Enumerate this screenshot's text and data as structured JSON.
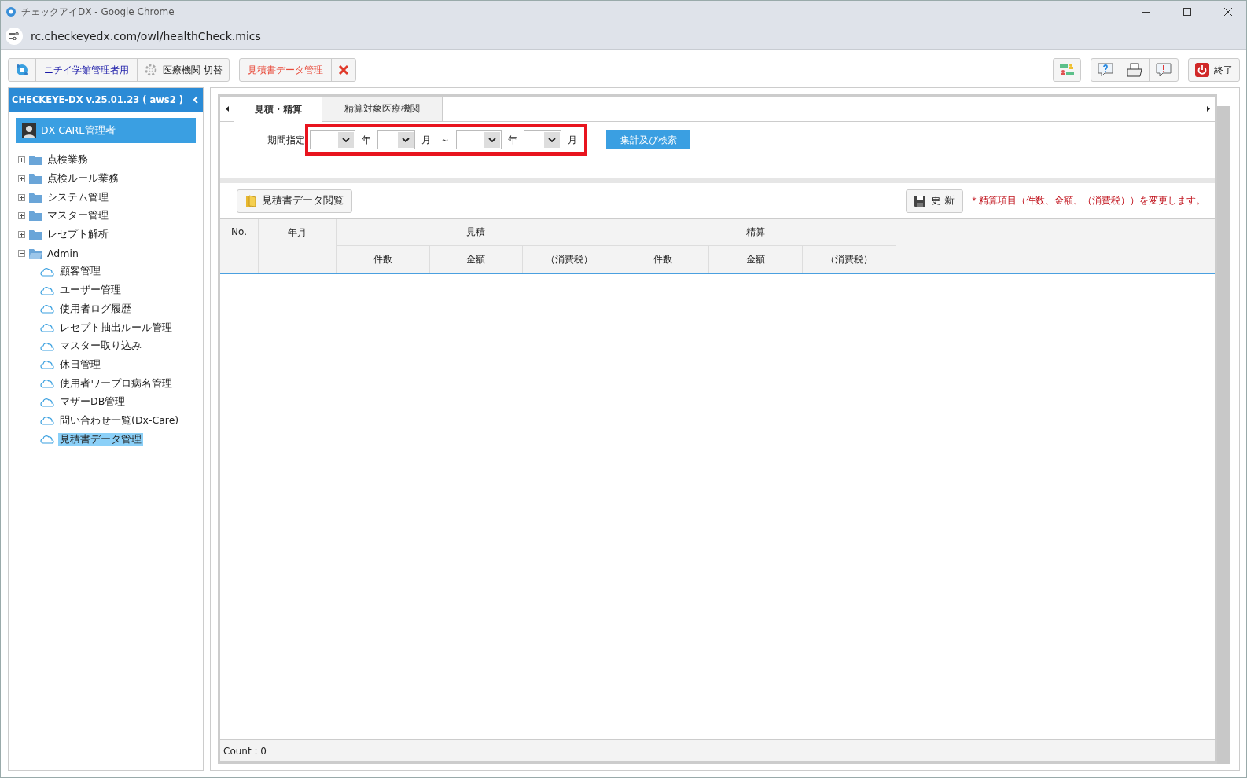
{
  "window": {
    "title": "チェックアイDX - Google Chrome",
    "url": "rc.checkeyedx.com/owl/healthCheck.mics"
  },
  "toolbar": {
    "org_label": "ニチイ学館管理者用",
    "switch_label": "医療機関 切替",
    "open_tab": "見積書データ管理",
    "exit_label": "終了"
  },
  "sidebar": {
    "version": "CHECKEYE-DX v.25.01.23 ( aws2 )",
    "user": "DX CARE管理者",
    "items": [
      {
        "label": "点検業務",
        "expanded": false
      },
      {
        "label": "点検ルール業務",
        "expanded": false
      },
      {
        "label": "システム管理",
        "expanded": false
      },
      {
        "label": "マスター管理",
        "expanded": false
      },
      {
        "label": "レセプト解析",
        "expanded": false
      },
      {
        "label": "Admin",
        "expanded": true,
        "children": [
          {
            "label": "顧客管理",
            "selected": false
          },
          {
            "label": "ユーザー管理",
            "selected": false
          },
          {
            "label": "使用者ログ履歴",
            "selected": false
          },
          {
            "label": "レセプト抽出ルール管理",
            "selected": false
          },
          {
            "label": "マスター取り込み",
            "selected": false
          },
          {
            "label": "休日管理",
            "selected": false
          },
          {
            "label": "使用者ワープロ病名管理",
            "selected": false
          },
          {
            "label": "マザーDB管理",
            "selected": false
          },
          {
            "label": "問い合わせ一覧(Dx-Care)",
            "selected": false
          },
          {
            "label": "見積書データ管理",
            "selected": true
          }
        ]
      }
    ]
  },
  "tabs": [
    {
      "label": "見積・精算",
      "selected": true
    },
    {
      "label": "精算対象医療機関",
      "selected": false
    }
  ],
  "filter": {
    "label": "期間指定",
    "highlighted": true,
    "from_year_unit": "年",
    "from_month_unit": "月",
    "to_year_unit": "年",
    "to_month_unit": "月",
    "range_sep": "～",
    "search_button": "集計及び検索"
  },
  "actions": {
    "view_button": "見積書データ閲覧",
    "update_button": "更 新",
    "note": "＊精算項目（件数、金額、（消費税））を変更します。"
  },
  "table": {
    "columns": [
      {
        "label": "No."
      },
      {
        "label": "年月"
      },
      {
        "label": "見積",
        "children": [
          "件数",
          "金額",
          "（消費税）"
        ]
      },
      {
        "label": "精算",
        "children": [
          "件数",
          "金額",
          "（消費税）"
        ]
      }
    ]
  },
  "status_bar": "Count : 0"
}
